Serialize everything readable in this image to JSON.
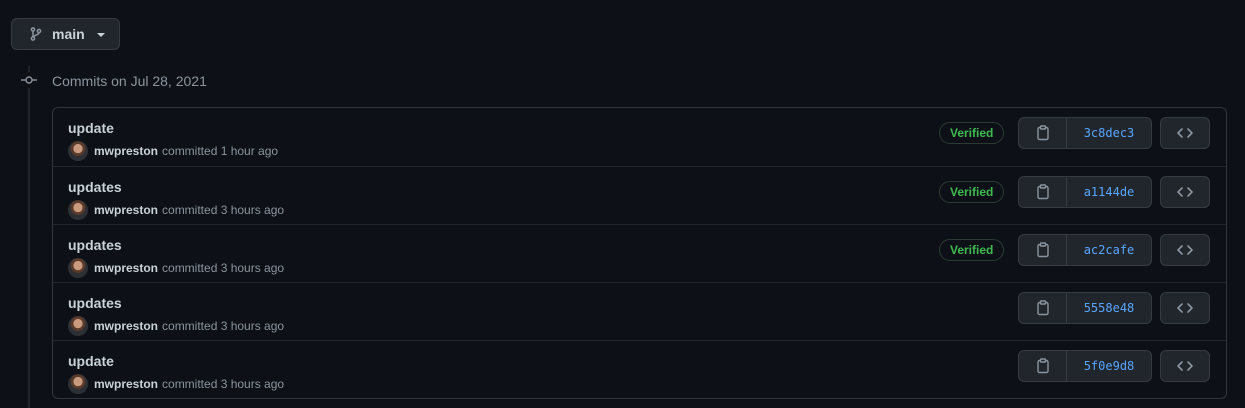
{
  "branch": {
    "label": "main",
    "icon": "git-branch-icon"
  },
  "timeline": {
    "heading": "Commits on Jul 28, 2021",
    "icon": "git-commit-icon"
  },
  "commits": [
    {
      "message": "update",
      "author": "mwpreston",
      "action": "committed 1 hour ago",
      "verified": "Verified",
      "sha": "3c8dec3"
    },
    {
      "message": "updates",
      "author": "mwpreston",
      "action": "committed 3 hours ago",
      "verified": "Verified",
      "sha": "a1144de"
    },
    {
      "message": "updates",
      "author": "mwpreston",
      "action": "committed 3 hours ago",
      "verified": "Verified",
      "sha": "ac2cafe"
    },
    {
      "message": "updates",
      "author": "mwpreston",
      "action": "committed 3 hours ago",
      "verified": null,
      "sha": "5558e48"
    },
    {
      "message": "update",
      "author": "mwpreston",
      "action": "committed 3 hours ago",
      "verified": null,
      "sha": "5f0e9d8"
    }
  ],
  "colors": {
    "background": "#0d1117",
    "link": "#58a6ff",
    "verified": "#3fb950",
    "muted": "#8b949e"
  }
}
